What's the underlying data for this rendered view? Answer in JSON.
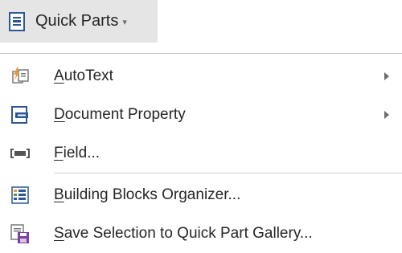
{
  "ribbon": {
    "button_label": "Quick Parts",
    "icon": "quick-parts-icon",
    "caret": "▾"
  },
  "menu": {
    "items": [
      {
        "accel": "A",
        "rest": "utoText",
        "icon": "autotext-icon",
        "has_submenu": true
      },
      {
        "accel": "D",
        "rest": "ocument Property",
        "icon": "document-property-icon",
        "has_submenu": true
      },
      {
        "accel": "F",
        "rest": "ield...",
        "icon": "field-icon",
        "has_submenu": false
      },
      {
        "accel": "B",
        "rest": "uilding Blocks Organizer...",
        "icon": "building-blocks-organizer-icon",
        "has_submenu": false
      },
      {
        "accel": "S",
        "rest": "ave Selection to Quick Part Gallery...",
        "icon": "save-selection-icon",
        "has_submenu": false
      }
    ]
  },
  "colors": {
    "accent_blue": "#2b579a",
    "save_purple": "#7b3f9e",
    "autotext_orange": "#e8a033",
    "ribbon_bg": "#e5e5e5",
    "text": "#262626"
  }
}
